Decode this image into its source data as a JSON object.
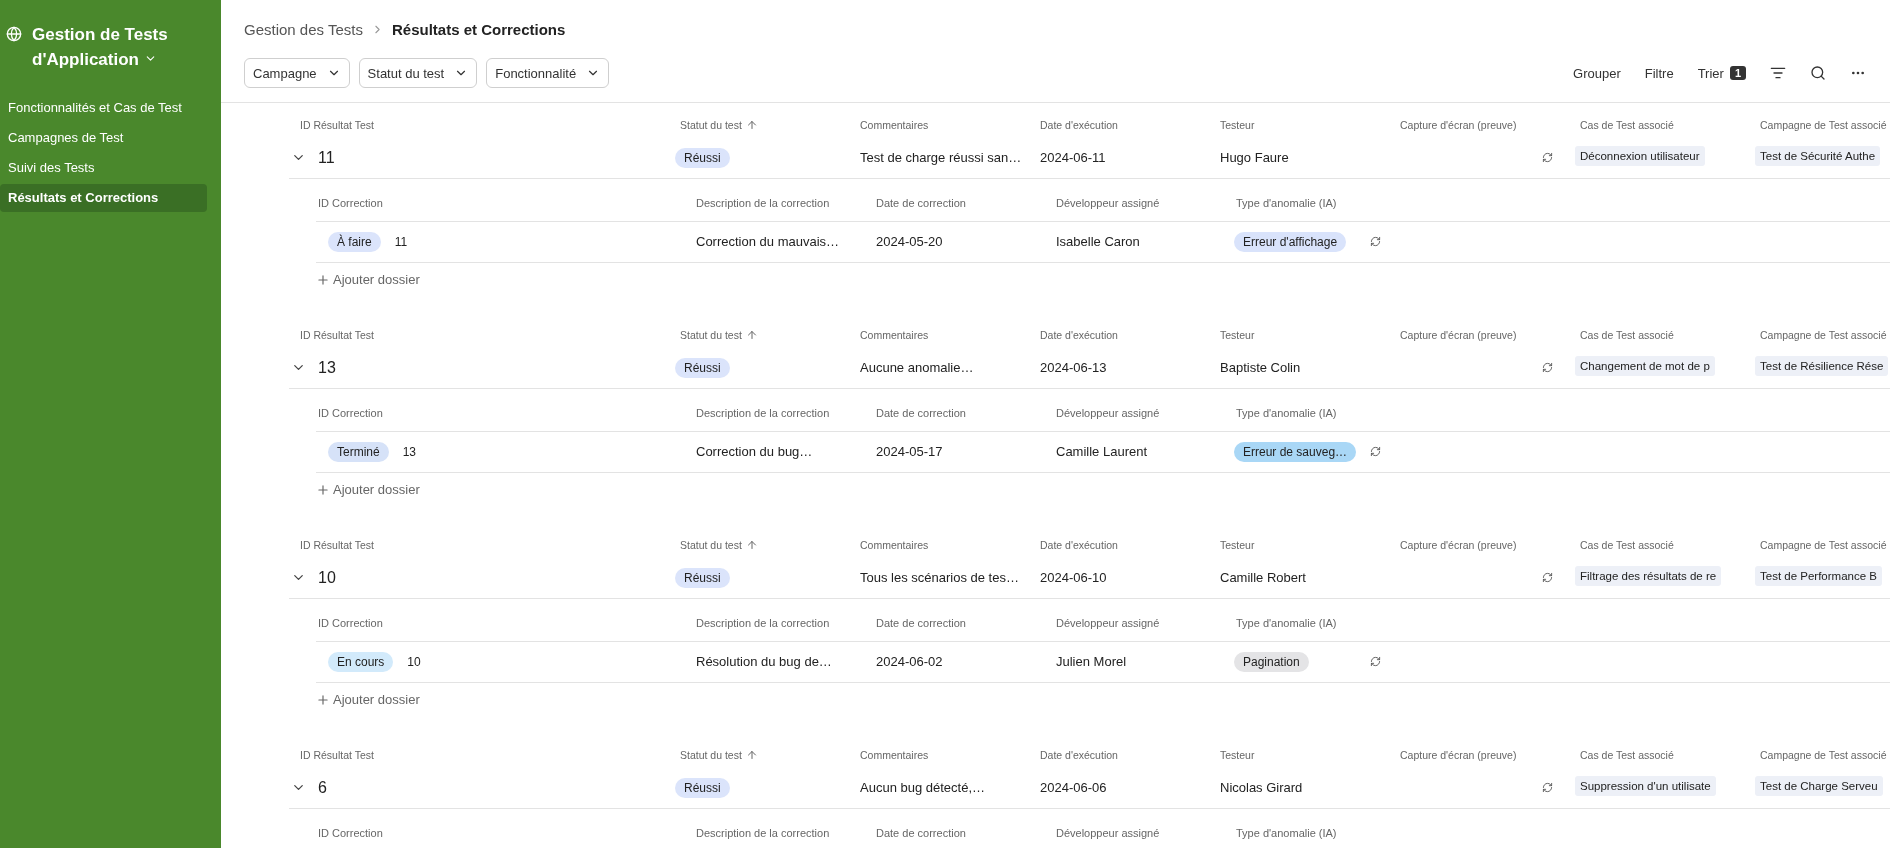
{
  "sidebar": {
    "title": "Gestion de Tests d'Application",
    "items": [
      {
        "label": "Fonctionnalités et Cas de Test",
        "selected": false
      },
      {
        "label": "Campagnes de Test",
        "selected": false
      },
      {
        "label": "Suivi des Tests",
        "selected": false
      },
      {
        "label": "Résultats et Corrections",
        "selected": true
      }
    ]
  },
  "breadcrumb": [
    "Gestion des Tests",
    "Résultats et Corrections"
  ],
  "filters": [
    "Campagne",
    "Statut du test",
    "Fonctionnalité"
  ],
  "toolbar": {
    "group": "Grouper",
    "filter": "Filtre",
    "sort": "Trier",
    "sort_count": "1"
  },
  "groups": [
    {
      "expanded": true,
      "columns": [
        {
          "label": "ID Résultat Test",
          "sorted": false
        },
        {
          "label": "Statut du test",
          "sorted": true
        },
        {
          "label": "Commentaires",
          "sorted": false
        },
        {
          "label": "Date d'exécution",
          "sorted": false
        },
        {
          "label": "Testeur",
          "sorted": false
        },
        {
          "label": "Capture d'écran (preuve)",
          "sorted": false
        },
        {
          "label": "Cas de Test associé",
          "sorted": false
        },
        {
          "label": "Campagne de Test associé",
          "sorted": false
        }
      ],
      "row": {
        "id": "11",
        "status": "Réussi",
        "comment": "Test de charge réussi san…",
        "date": "2024-06-11",
        "tester": "Hugo Faure",
        "case": "Déconnexion utilisateur",
        "campaign": "Test de Sécurité Authe"
      },
      "sub_columns": [
        "ID Correction",
        "Description de la correction",
        "Date de correction",
        "Développeur assigné",
        "Type d'anomalie (IA)"
      ],
      "corrections": [
        {
          "status": {
            "label": "À faire",
            "color": "#dbe4fb"
          },
          "id": "11",
          "description": "Correction du mauvais…",
          "date": "2024-05-20",
          "developer": "Isabelle Caron",
          "anomaly": {
            "label": "Erreur d'affichage",
            "color": "#d9e3fb"
          }
        }
      ],
      "add_label": "Ajouter dossier"
    },
    {
      "expanded": true,
      "columns": [
        {
          "label": "ID Résultat Test",
          "sorted": false
        },
        {
          "label": "Statut du test",
          "sorted": true
        },
        {
          "label": "Commentaires",
          "sorted": false
        },
        {
          "label": "Date d'exécution",
          "sorted": false
        },
        {
          "label": "Testeur",
          "sorted": false
        },
        {
          "label": "Capture d'écran (preuve)",
          "sorted": false
        },
        {
          "label": "Cas de Test associé",
          "sorted": false
        },
        {
          "label": "Campagne de Test associé",
          "sorted": false
        }
      ],
      "row": {
        "id": "13",
        "status": "Réussi",
        "comment": "Aucune anomalie…",
        "date": "2024-06-13",
        "tester": "Baptiste Colin",
        "case": "Changement de mot de p",
        "campaign": "Test de Résilience Rése"
      },
      "sub_columns": [
        "ID Correction",
        "Description de la correction",
        "Date de correction",
        "Développeur assigné",
        "Type d'anomalie (IA)"
      ],
      "corrections": [
        {
          "status": {
            "label": "Terminé",
            "color": "#d6e2f8"
          },
          "id": "13",
          "description": "Correction du bug…",
          "date": "2024-05-17",
          "developer": "Camille Laurent",
          "anomaly": {
            "label": "Erreur de sauveg…",
            "color": "#a9d7f6"
          }
        }
      ],
      "add_label": "Ajouter dossier"
    },
    {
      "expanded": true,
      "columns": [
        {
          "label": "ID Résultat Test",
          "sorted": false
        },
        {
          "label": "Statut du test",
          "sorted": true
        },
        {
          "label": "Commentaires",
          "sorted": false
        },
        {
          "label": "Date d'exécution",
          "sorted": false
        },
        {
          "label": "Testeur",
          "sorted": false
        },
        {
          "label": "Capture d'écran (preuve)",
          "sorted": false
        },
        {
          "label": "Cas de Test associé",
          "sorted": false
        },
        {
          "label": "Campagne de Test associé",
          "sorted": false
        }
      ],
      "row": {
        "id": "10",
        "status": "Réussi",
        "comment": "Tous les scénarios de tes…",
        "date": "2024-06-10",
        "tester": "Camille Robert",
        "case": "Filtrage des résultats de re",
        "campaign": "Test de Performance B"
      },
      "sub_columns": [
        "ID Correction",
        "Description de la correction",
        "Date de correction",
        "Développeur assigné",
        "Type d'anomalie (IA)"
      ],
      "corrections": [
        {
          "status": {
            "label": "En cours",
            "color": "#d2eafb"
          },
          "id": "10",
          "description": "Résolution du bug de…",
          "date": "2024-06-02",
          "developer": "Julien Morel",
          "anomaly": {
            "label": "Pagination",
            "color": "#e4e4e6"
          }
        }
      ],
      "add_label": "Ajouter dossier"
    },
    {
      "expanded": true,
      "columns": [
        {
          "label": "ID Résultat Test",
          "sorted": false
        },
        {
          "label": "Statut du test",
          "sorted": true
        },
        {
          "label": "Commentaires",
          "sorted": false
        },
        {
          "label": "Date d'exécution",
          "sorted": false
        },
        {
          "label": "Testeur",
          "sorted": false
        },
        {
          "label": "Capture d'écran (preuve)",
          "sorted": false
        },
        {
          "label": "Cas de Test associé",
          "sorted": false
        },
        {
          "label": "Campagne de Test associé",
          "sorted": false
        }
      ],
      "row": {
        "id": "6",
        "status": "Réussi",
        "comment": "Aucun bug détecté,…",
        "date": "2024-06-06",
        "tester": "Nicolas Girard",
        "case": "Suppression d'un utilisate",
        "campaign": "Test de Charge Serveu"
      },
      "sub_columns": [
        "ID Correction",
        "Description de la correction",
        "Date de correction",
        "Développeur assigné",
        "Type d'anomalie (IA)"
      ]
    }
  ]
}
